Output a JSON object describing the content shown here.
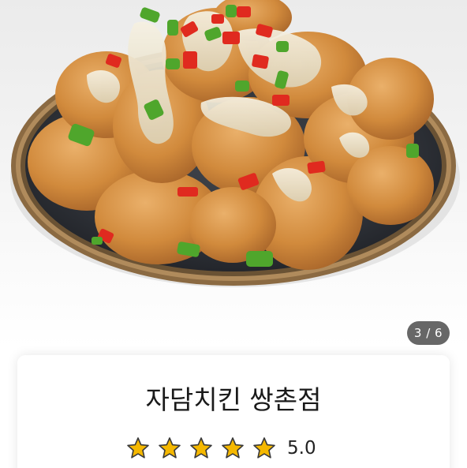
{
  "gallery": {
    "image_description_icon": "chicken-dish-photo",
    "page_current": 3,
    "page_total": 6,
    "page_indicator_text": "3 / 6"
  },
  "store": {
    "name": "자담치킨 쌍촌점",
    "rating_value": "5.0",
    "rating_stars": 5,
    "rating_max": 5,
    "star_color": "#F5B800"
  },
  "colors": {
    "indicator_bg": "#464646",
    "plate": "#2f3238",
    "plate_rim": "#9a7a52",
    "chicken": "#d7903f",
    "sauce": "#ece4cf",
    "red_pepper": "#e02a1f",
    "green_pepper": "#4fa62c"
  }
}
